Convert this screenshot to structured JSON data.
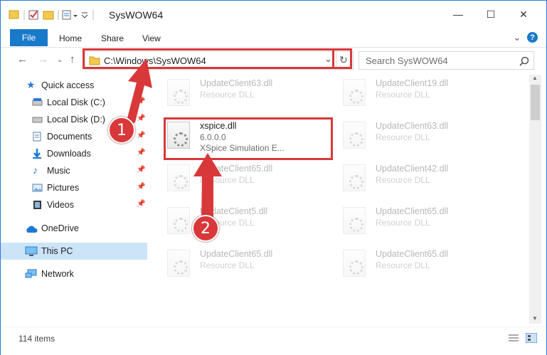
{
  "window": {
    "title": "SysWOW64",
    "minimize": "—",
    "maximize": "☐",
    "close": "✕"
  },
  "ribbon": {
    "tabs": [
      "File",
      "Home",
      "Share",
      "View"
    ],
    "help": "?",
    "expand": "⌄"
  },
  "address": {
    "path": "C:\\Windows\\SysWOW64",
    "search_placeholder": "Search SysWOW64"
  },
  "sidebar": {
    "items": [
      {
        "label": "Quick access",
        "icon": "star-icon",
        "pinned": false
      },
      {
        "label": "Local Disk (C:)",
        "icon": "drive-icon",
        "pinned": true
      },
      {
        "label": "Local Disk (D:)",
        "icon": "drive-icon",
        "pinned": true
      },
      {
        "label": "Documents",
        "icon": "documents-icon",
        "pinned": true
      },
      {
        "label": "Downloads",
        "icon": "downloads-icon",
        "pinned": true
      },
      {
        "label": "Music",
        "icon": "music-icon",
        "pinned": true
      },
      {
        "label": "Pictures",
        "icon": "pictures-icon",
        "pinned": true
      },
      {
        "label": "Videos",
        "icon": "videos-icon",
        "pinned": true
      },
      {
        "label": "OneDrive",
        "icon": "cloud-icon",
        "pinned": false
      },
      {
        "label": "This PC",
        "icon": "computer-icon",
        "pinned": false
      },
      {
        "label": "Network",
        "icon": "network-icon",
        "pinned": false
      }
    ]
  },
  "files": [
    {
      "name": "UpdateClient63.dll",
      "desc": "Resource DLL",
      "faded": true
    },
    {
      "name": "UpdateClient19.dll",
      "desc": "Resource DLL",
      "faded": true
    },
    {
      "name": "xspice.dll",
      "desc": "6.0.0.0",
      "desc2": "XSpice Simulation E...",
      "faded": false
    },
    {
      "name": "UpdateClient63.dll",
      "desc": "Resource DLL",
      "faded": true
    },
    {
      "name": "UpdateClient65.dll",
      "desc": "Resource DLL",
      "faded": true
    },
    {
      "name": "UpdateClient42.dll",
      "desc": "Resource DLL",
      "faded": true
    },
    {
      "name": "UpdateClient5.dll",
      "desc": "Resource DLL",
      "faded": true
    },
    {
      "name": "UpdateClient65.dll",
      "desc": "Resource DLL",
      "faded": true
    },
    {
      "name": "UpdateClient65.dll",
      "desc": "Resource DLL",
      "faded": true
    },
    {
      "name": "UpdateClient65.dll",
      "desc": "Resource DLL",
      "faded": true
    }
  ],
  "status": {
    "count": "114 items"
  },
  "annotations": {
    "step1": "1",
    "step2": "2",
    "color": "#d9383a"
  }
}
